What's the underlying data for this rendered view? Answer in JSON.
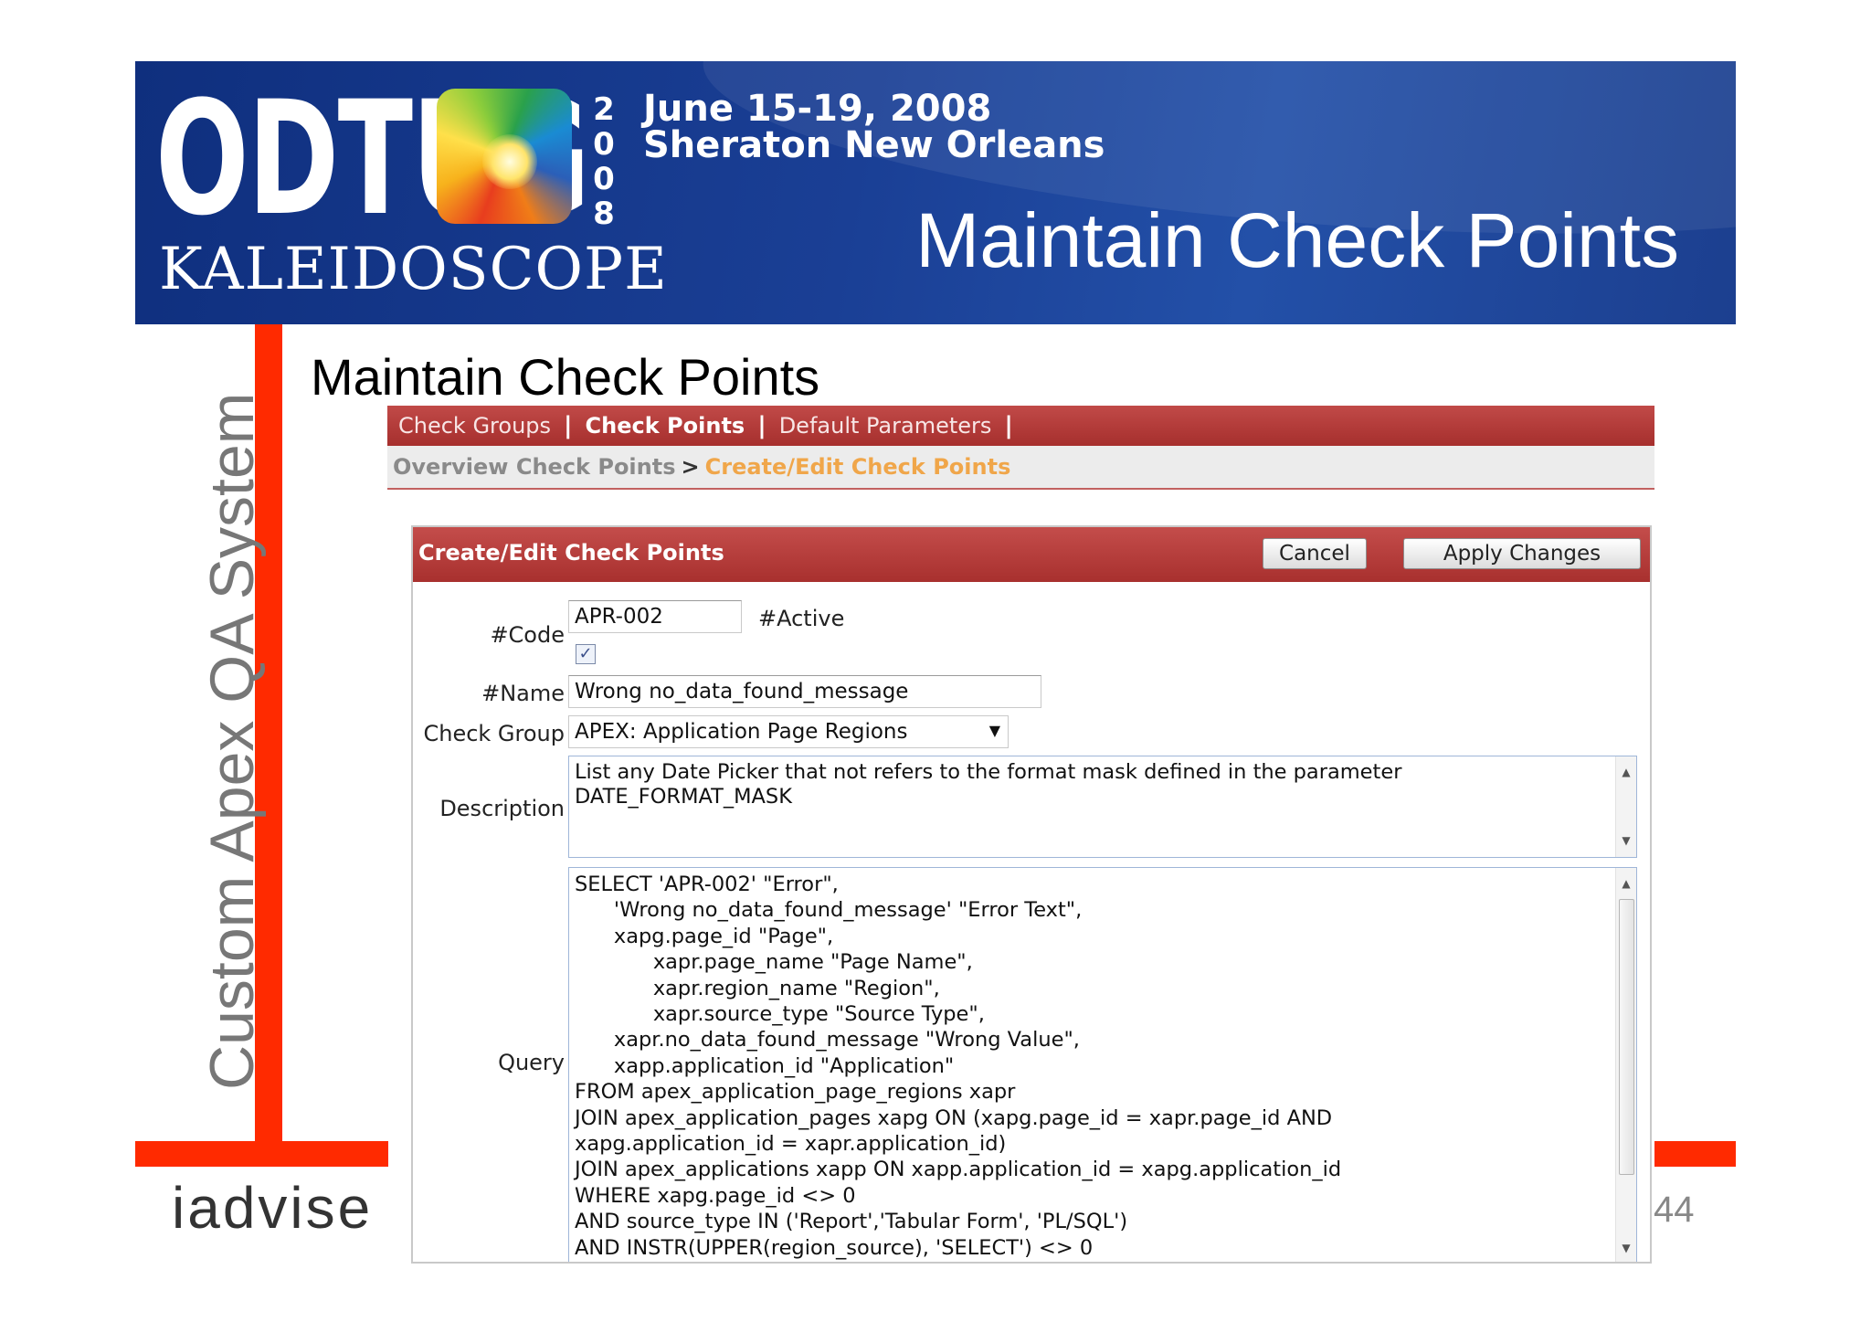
{
  "banner": {
    "logo_text": "ODTUG",
    "logo_subtext": "KALEIDOSCOPE",
    "year_digits": [
      "2",
      "0",
      "0",
      "8"
    ],
    "conference_dates": "June 15-19, 2008",
    "conference_location": "Sheraton New Orleans",
    "title": "Maintain Check Points",
    "colors": {
      "background": "#1a3f95",
      "text": "#ffffff"
    }
  },
  "sidebar": {
    "vertical_title": "Custom Apex QA System",
    "accent_color": "#ff2a00"
  },
  "footer": {
    "logo": "iadvise",
    "page_number": "44"
  },
  "slide_heading": "Maintain Check Points",
  "app": {
    "tabs": [
      {
        "label": "Check Groups",
        "active": false
      },
      {
        "label": "Check Points",
        "active": true
      },
      {
        "label": "Default Parameters",
        "active": false
      }
    ],
    "tab_separator": "|",
    "breadcrumb": {
      "parent": "Overview Check Points",
      "separator": ">",
      "current": "Create/Edit Check Points"
    },
    "region": {
      "title": "Create/Edit Check Points",
      "cancel_label": "Cancel",
      "apply_label": "Apply Changes"
    },
    "form": {
      "code_label": "#Code",
      "code_value": "APR-002",
      "active_label": "#Active",
      "active_checked": true,
      "checkbox_glyph": "✓",
      "name_label": "#Name",
      "name_value": "Wrong no_data_found_message",
      "check_group_label": "Check Group",
      "check_group_value": "APEX: Application Page Regions",
      "description_label": "Description",
      "description_lines": [
        "List any Date Picker that not refers to the format mask defined in the parameter",
        "DATE_FORMAT_MASK"
      ],
      "query_label": "Query",
      "query_lines": [
        "SELECT 'APR-002' \"Error\",",
        "      'Wrong no_data_found_message' \"Error Text\",",
        "      xapg.page_id \"Page\",",
        "            xapr.page_name \"Page Name\",",
        "            xapr.region_name \"Region\",",
        "            xapr.source_type \"Source Type\",",
        "      xapr.no_data_found_message \"Wrong Value\",",
        "      xapp.application_id \"Application\"",
        "FROM apex_application_page_regions xapr",
        "JOIN apex_application_pages xapg ON (xapg.page_id = xapr.page_id AND",
        "xapg.application_id = xapr.application_id)",
        "JOIN apex_applications xapp ON xapp.application_id = xapg.application_id",
        "WHERE xapg.page_id <> 0",
        "AND source_type IN ('Report','Tabular Form', 'PL/SQL')",
        "AND INSTR(UPPER(region_source), 'SELECT') <> 0"
      ]
    }
  }
}
